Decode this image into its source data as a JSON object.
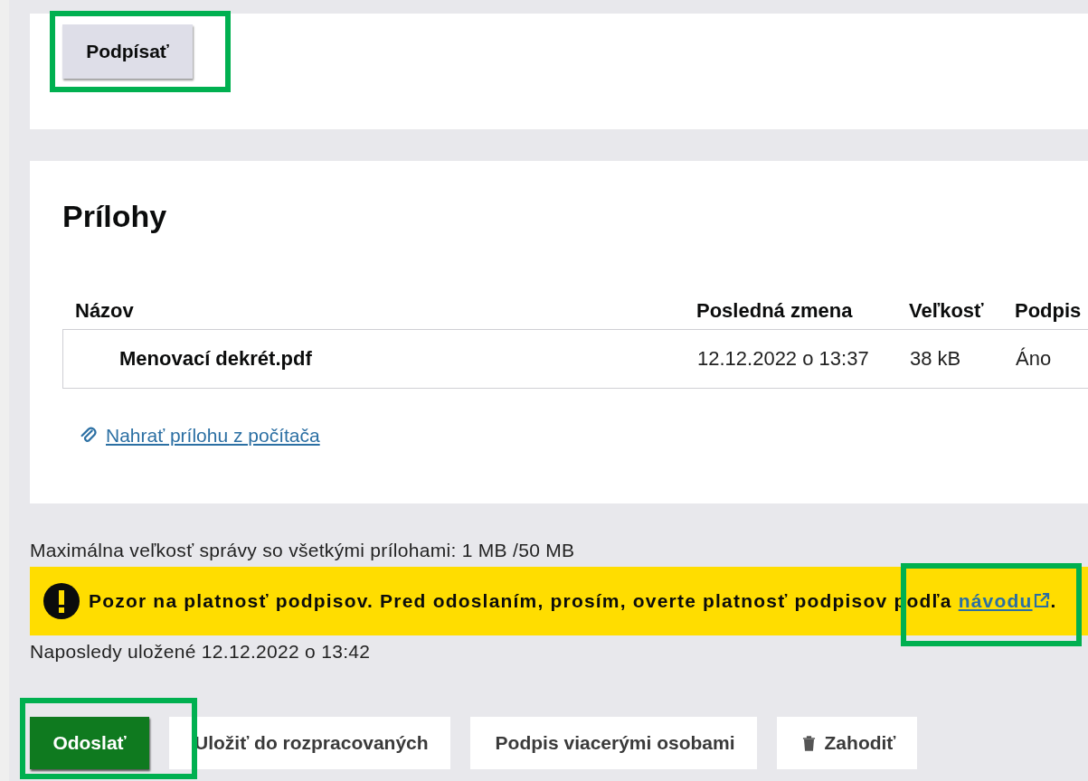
{
  "sign_button": {
    "label": "Podpísať"
  },
  "attachments": {
    "heading": "Prílohy",
    "columns": [
      "Názov",
      "Posledná zmena",
      "Veľkosť",
      "Podpis"
    ],
    "rows": [
      {
        "name": "Menovací dekrét.pdf",
        "modified": "12.12.2022 o 13:37",
        "size": "38 kB",
        "signed": "Áno"
      }
    ],
    "upload_link": "Nahrať prílohu z počítača"
  },
  "max_size": "Maximálna veľkosť správy so všetkými prílohami: 1 MB /50 MB",
  "warning": {
    "text": "Pozor na platnosť podpisov. Pred odoslaním, prosím, overte platnosť podpisov podľa ",
    "link": "návodu",
    "end": "."
  },
  "saved": "Naposledy uložené 12.12.2022 o 13:42",
  "actions": [
    {
      "label": "Odoslať",
      "kind": "primary"
    },
    {
      "label": "Uložiť do rozpracovaných",
      "kind": "secondary"
    },
    {
      "label": "Podpis viacerými osobami",
      "kind": "secondary"
    },
    {
      "label": "Zahodiť",
      "kind": "delete"
    }
  ]
}
